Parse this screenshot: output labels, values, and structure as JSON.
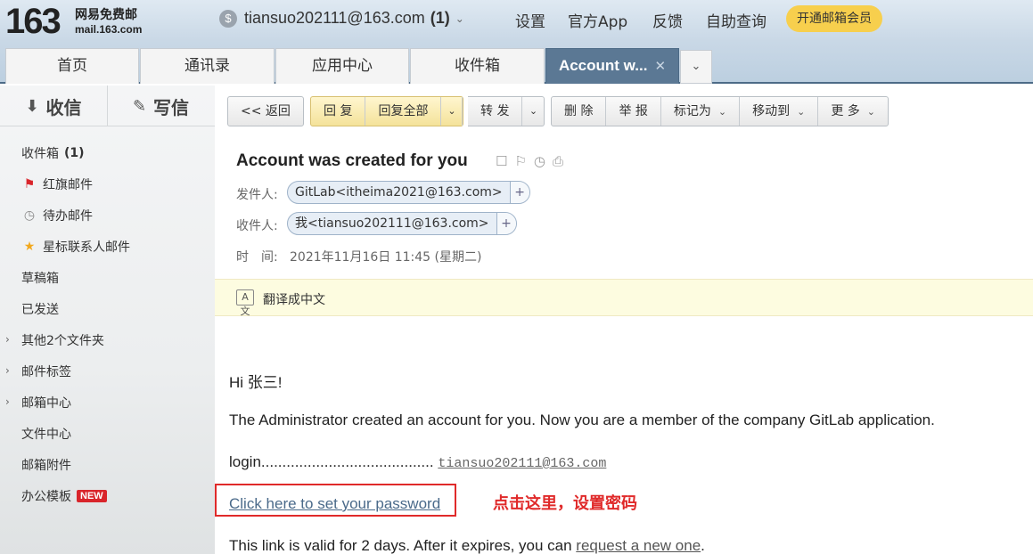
{
  "header": {
    "logo_number": "163",
    "logo_name": "网易免费邮",
    "logo_domain": "mail.163.com",
    "account": "tiansuo202111@163.com",
    "account_count": "(1)",
    "nav": [
      "设置",
      "官方App",
      "反馈",
      "自助查询"
    ],
    "vip_button": "开通邮箱会员"
  },
  "tabs": [
    {
      "label": "首页"
    },
    {
      "label": "通讯录"
    },
    {
      "label": "应用中心"
    },
    {
      "label": "收件箱"
    },
    {
      "label": "Account w...",
      "active": true
    }
  ],
  "sidebar": {
    "receive": "收信",
    "compose": "写信",
    "items": [
      {
        "label": "收件箱",
        "count": "(1)"
      },
      {
        "label": "红旗邮件",
        "icon": "flag-icon"
      },
      {
        "label": "待办邮件",
        "icon": "clock-icon"
      },
      {
        "label": "星标联系人邮件",
        "icon": "star-icon"
      },
      {
        "label": "草稿箱"
      },
      {
        "label": "已发送"
      },
      {
        "label": "其他2个文件夹",
        "expandable": true
      },
      {
        "label": "邮件标签",
        "expandable": true
      },
      {
        "label": "邮箱中心",
        "expandable": true
      },
      {
        "label": "文件中心"
      },
      {
        "label": "邮箱附件"
      },
      {
        "label": "办公模板",
        "badge": "NEW"
      }
    ]
  },
  "toolbar": {
    "back": "<< 返回",
    "reply": "回 复",
    "reply_all": "回复全部",
    "forward": "转 发",
    "delete": "删 除",
    "report": "举 报",
    "mark_as": "标记为",
    "move_to": "移动到",
    "more": "更 多"
  },
  "email": {
    "subject": "Account was created for you",
    "from_label": "发件人:",
    "from": "GitLab<itheima2021@163.com>",
    "to_label": "收件人:",
    "to": "我<tiansuo202111@163.com>",
    "time_label": "时　间:",
    "time": "2021年11月16日 11:45 (星期二)",
    "translate": "翻译成中文",
    "greeting": "Hi 张三!",
    "line1": "The Administrator created an account for you. Now you are a member of the company GitLab application.",
    "login_label": "login.........................................",
    "login_value": "tiansuo202111@163.com",
    "set_password_link": "Click here to set your password",
    "annotation": "点击这里，设置密码",
    "validity_text": "This link is valid for 2 days. After it expires, you can ",
    "request_link": "request a new one",
    "validity_end": "."
  },
  "colors": {
    "accent": "#5b7894",
    "annotation_red": "#e02a2a",
    "vip_yellow": "#f7cf4d"
  }
}
